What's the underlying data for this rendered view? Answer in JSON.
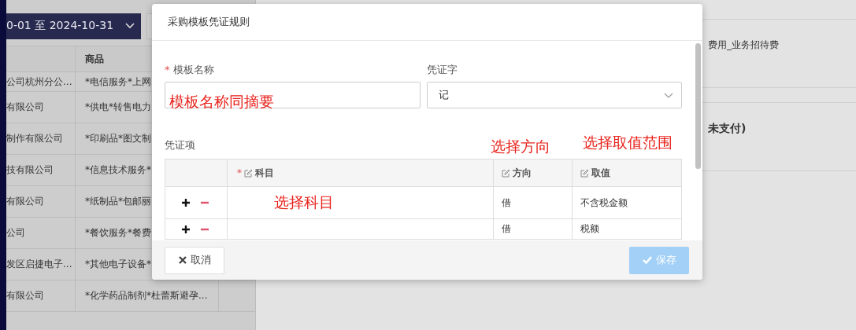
{
  "date_range": {
    "value": "0-01 至 2024-10-31"
  },
  "background_table": {
    "goods_header": "商品",
    "rows": [
      {
        "company": "公司杭州分公...",
        "goods": "*电信服务*上网"
      },
      {
        "company": "有限公司",
        "goods": "*供电*转售电力"
      },
      {
        "company": "制作有限公司",
        "goods": "*印刷品*图文制"
      },
      {
        "company": "技有限公司",
        "goods": "*信息技术服务*"
      },
      {
        "company": "有限公司",
        "goods": "*纸制品*包邮丽"
      },
      {
        "company": "公司",
        "goods": "*餐饮服务*餐费"
      },
      {
        "company": "发区启捷电子...",
        "goods": "*其他电子设备*"
      },
      {
        "company": "有限公司",
        "goods": "*化学药品制剂*杜蕾斯避孕..."
      }
    ]
  },
  "side_cards": [
    {
      "kind": "detail",
      "text": "费用_业务招待费"
    },
    {
      "kind": "heading",
      "text": "未支付)"
    }
  ],
  "dialog": {
    "title": "采购模板凭证规则",
    "fields": [
      {
        "kind": "input",
        "label": "模板名称",
        "required_mark": "*"
      },
      {
        "kind": "select",
        "label": "凭证字",
        "value": "记"
      }
    ],
    "section_label": "凭证项",
    "columns": [
      {
        "label": "科目",
        "required_mark": "*",
        "editable": true
      },
      {
        "label": "方向",
        "editable": true
      },
      {
        "label": "取值",
        "editable": true
      }
    ],
    "rows": [
      {
        "direction": "借",
        "value": "不含税金额"
      },
      {
        "direction": "借",
        "value": "税额"
      }
    ],
    "annotations": [
      "模板名称同摘要",
      "选择方向",
      "选择取值范围",
      "选择科目"
    ],
    "cancel_button": {
      "label": "取消"
    },
    "save_button": {
      "label": "保存",
      "disabled": true
    }
  }
}
